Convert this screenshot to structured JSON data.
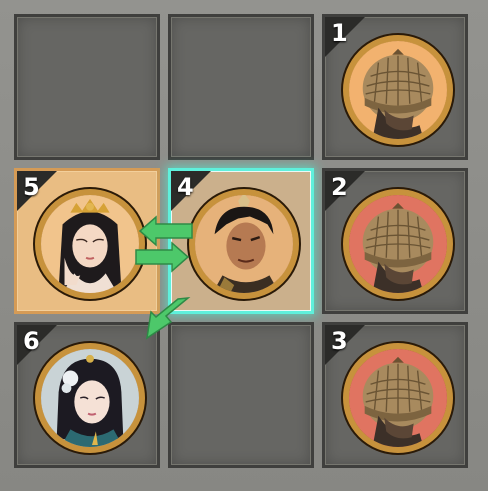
{
  "grid": {
    "cells": [
      {
        "id": "r1c1",
        "label": "",
        "state": "empty"
      },
      {
        "id": "r1c2",
        "label": "",
        "state": "empty"
      },
      {
        "id": "r1c3",
        "label": "1",
        "state": "enemy",
        "portrait": "soldier-helmet-icon",
        "ring": "amber"
      },
      {
        "id": "r2c1",
        "label": "5",
        "state": "highlight",
        "portrait": "lady-crown-icon",
        "ring": "amber"
      },
      {
        "id": "r2c2",
        "label": "4",
        "state": "active",
        "portrait": "warrior-topknot-icon",
        "ring": "amber"
      },
      {
        "id": "r2c3",
        "label": "2",
        "state": "enemy",
        "portrait": "soldier-helmet-icon",
        "ring": "red"
      },
      {
        "id": "r3c1",
        "label": "6",
        "state": "ally",
        "portrait": "lady-flower-icon",
        "ring": "amber"
      },
      {
        "id": "r3c2",
        "label": "",
        "state": "empty"
      },
      {
        "id": "r3c3",
        "label": "3",
        "state": "enemy",
        "portrait": "soldier-helmet-icon",
        "ring": "red"
      }
    ]
  },
  "arrows": [
    {
      "from": "4",
      "to": "5",
      "icon": "arrow-left-icon"
    },
    {
      "from": "5",
      "to": "4",
      "icon": "arrow-right-icon"
    },
    {
      "from": "4",
      "to": "6",
      "icon": "arrow-down-left-icon"
    }
  ],
  "colors": {
    "arrow": "#4dc86a",
    "highlight": "#e9bd83",
    "active_border": "#5ff0dc",
    "red_ring": "#e07461",
    "gold_frame": "#c7923c"
  }
}
